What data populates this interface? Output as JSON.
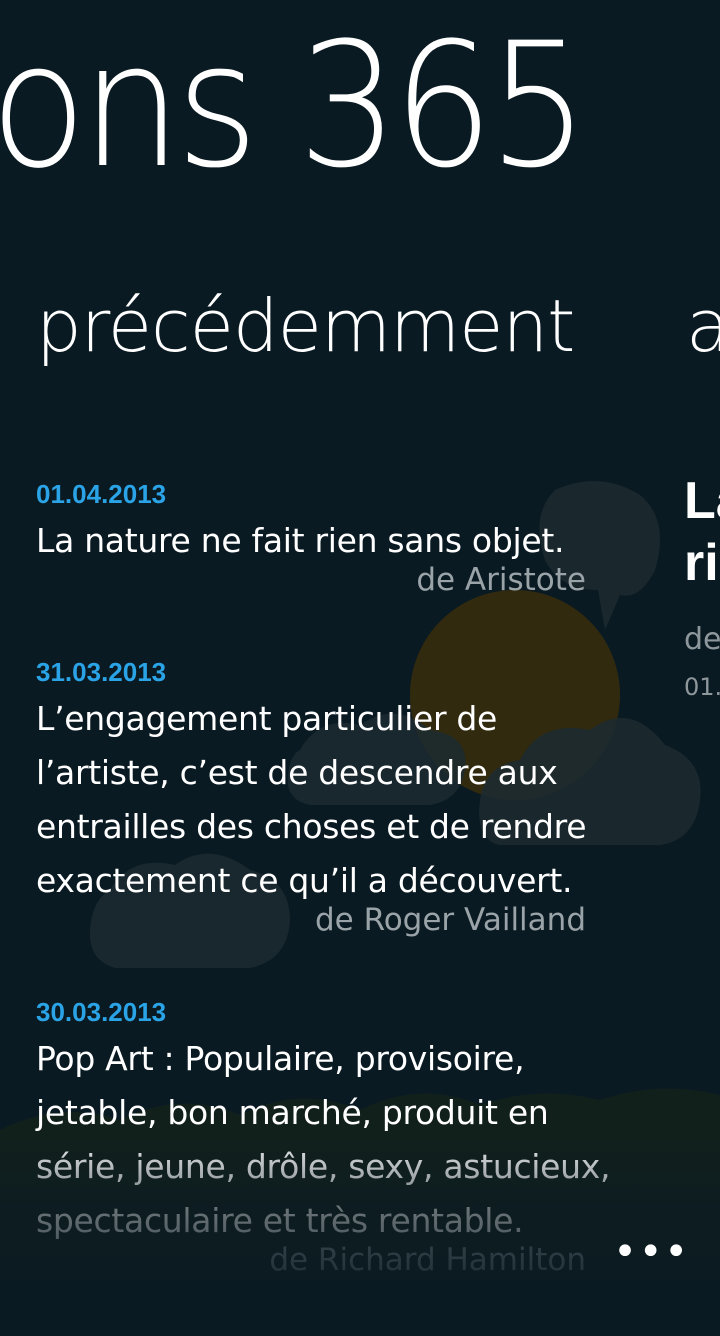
{
  "app": {
    "title": "ons 365"
  },
  "pivot": {
    "current": "précédemment",
    "next": "a"
  },
  "quotes": [
    {
      "date": "01.04.2013",
      "text": "La nature ne fait rien sans objet.",
      "author": "de Aristote"
    },
    {
      "date": "31.03.2013",
      "text": "L’engagement particulier de l’artiste, c’est de descendre aux entrailles des choses et de rendre exactement ce qu’il a découvert.",
      "author": "de Roger Vailland"
    },
    {
      "date": "30.03.2013",
      "text": "Pop Art : Populaire, provisoire, jetable, bon marché, produit en série, jeune, drôle, sexy, astucieux, spectaculaire et très rentable.",
      "author": "de Richard Hamilton"
    }
  ],
  "next_panel": {
    "quote": "La\nri",
    "author": "de",
    "date": "01."
  },
  "app_bar": {
    "more_label": "•••"
  },
  "colors": {
    "background": "#0a1a22",
    "accent": "#2aa4e6"
  }
}
